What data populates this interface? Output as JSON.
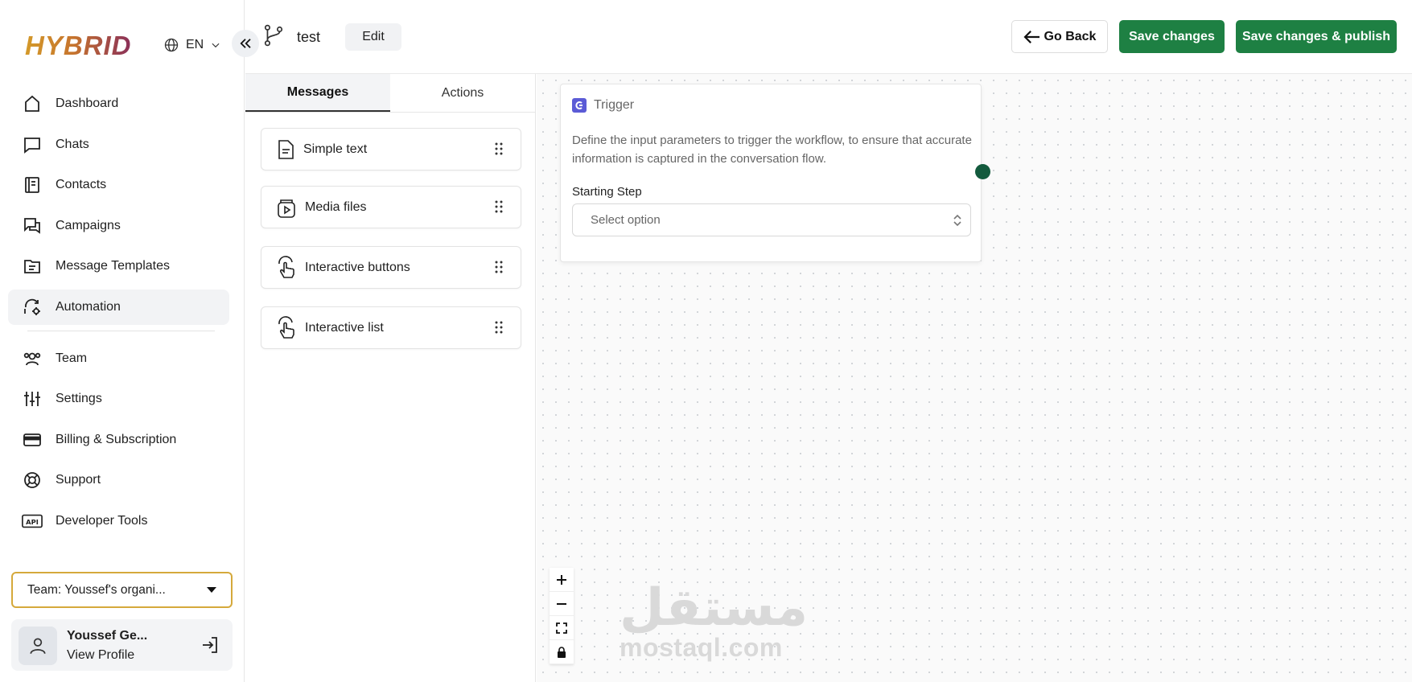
{
  "sidebar": {
    "logo": "HYBRID",
    "language": "EN",
    "items": [
      {
        "label": "Dashboard",
        "icon": "home-icon"
      },
      {
        "label": "Chats",
        "icon": "chat-icon"
      },
      {
        "label": "Contacts",
        "icon": "contacts-icon"
      },
      {
        "label": "Campaigns",
        "icon": "campaigns-icon"
      },
      {
        "label": "Message Templates",
        "icon": "templates-icon"
      },
      {
        "label": "Automation",
        "icon": "automation-icon",
        "active": true
      },
      {
        "label": "Team",
        "icon": "team-icon"
      },
      {
        "label": "Settings",
        "icon": "settings-icon"
      },
      {
        "label": "Billing & Subscription",
        "icon": "billing-icon"
      },
      {
        "label": "Support",
        "icon": "support-icon"
      },
      {
        "label": "Developer Tools",
        "icon": "api-icon"
      }
    ],
    "team_select": "Team: Youssef's organi...",
    "profile": {
      "name": "Youssef Ge...",
      "link": "View Profile"
    }
  },
  "header": {
    "flow_name": "test",
    "edit_label": "Edit",
    "go_back_label": "Go Back",
    "save_label": "Save changes",
    "save_publish_label": "Save changes & publish"
  },
  "palette": {
    "tabs": [
      "Messages",
      "Actions"
    ],
    "active_tab": "Messages",
    "blocks": [
      "Simple text",
      "Media files",
      "Interactive buttons",
      "Interactive list"
    ]
  },
  "canvas": {
    "trigger": {
      "title": "Trigger",
      "description": "Define the input parameters to trigger the workflow, to ensure that accurate information is captured in the conversation flow.",
      "starting_step_label": "Starting Step",
      "select_placeholder": "Select option"
    },
    "watermark": {
      "arabic": "مستقل",
      "latin": "mostaql.com"
    }
  },
  "colors": {
    "accent_green": "#1e8043",
    "handle": "#135a3d",
    "team_border": "#d5a93b",
    "trigger_icon": "#5b5bd6"
  }
}
